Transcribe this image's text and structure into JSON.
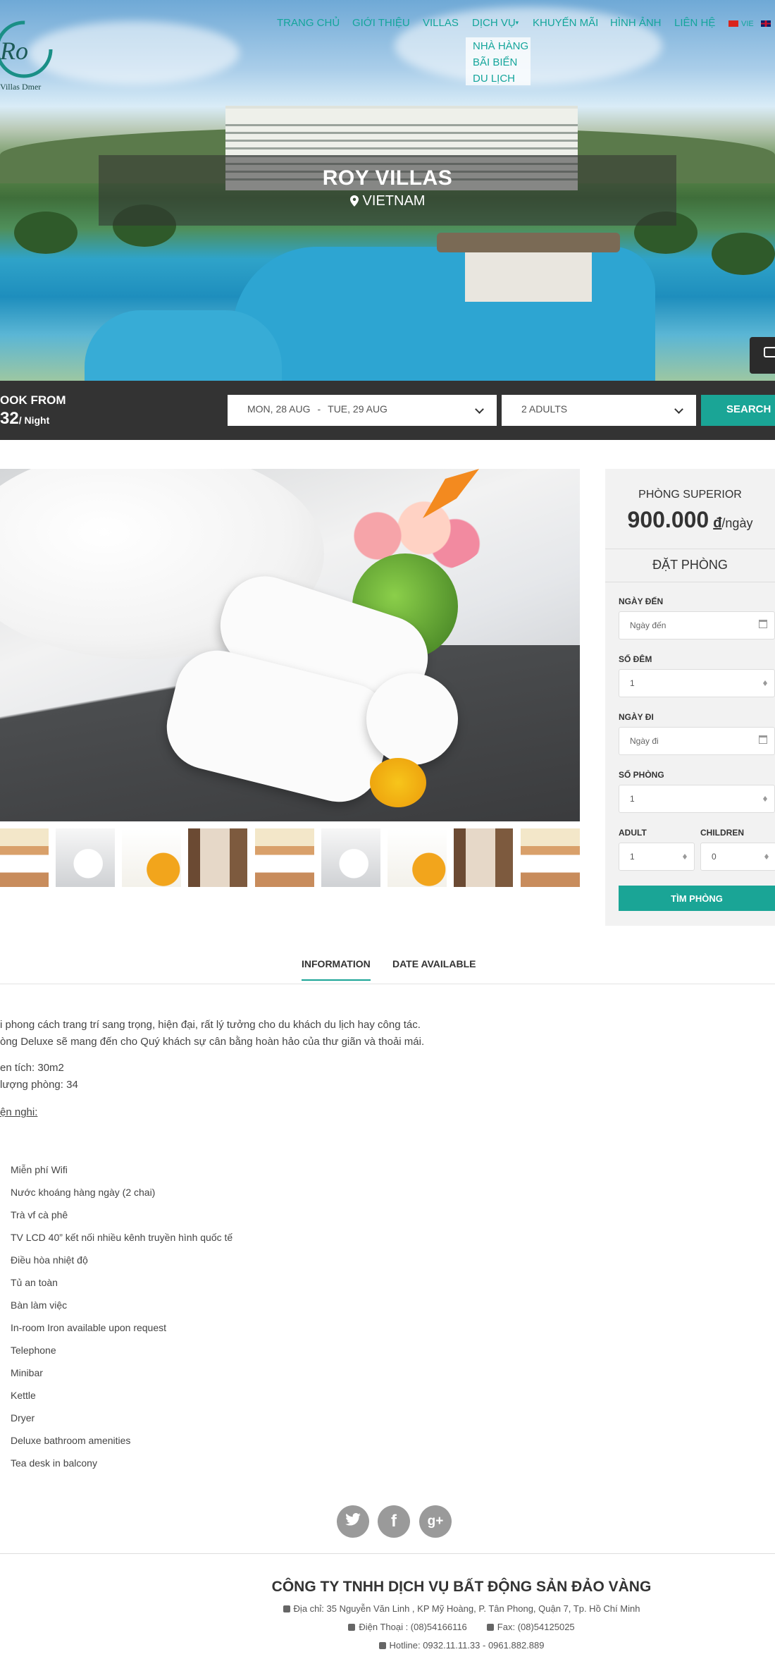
{
  "brand": {
    "logo_text": "Villas Dmer",
    "logo_mark": "Ro"
  },
  "nav": {
    "items": [
      "TRANG CHỦ",
      "GIỚI THIỆU",
      "VILLAS",
      "DỊCH VỤ",
      "KHUYẾN MÃI",
      "HÌNH ẢNH",
      "LIÊN HỆ"
    ],
    "submenu": [
      "NHÀ HÀNG",
      "BÃI BIỂN",
      "DU LỊCH"
    ],
    "lang": [
      "VIE"
    ],
    "accent": "#14a59b"
  },
  "hero": {
    "title": "ROY VILLAS",
    "location": "VIETNAM"
  },
  "bookbar": {
    "label": "OOK FROM",
    "price": "32",
    "per": "/ Night",
    "checkin": "MON, 28 AUG",
    "checkout": "TUE, 29 AUG",
    "dash": "-",
    "guests": "2 ADULTS",
    "search": "SEARCH"
  },
  "sidebar": {
    "room_name": "PHÒNG SUPERIOR",
    "price": "900.000",
    "currency": "đ",
    "unit": "/ngày",
    "book_title": "ĐẶT PHÒNG",
    "arrive_label": "NGÀY ĐẾN",
    "arrive_placeholder": "Ngày đến",
    "nights_label": "SỐ ĐÊM",
    "nights_value": "1",
    "depart_label": "NGÀY ĐI",
    "depart_placeholder": "Ngày đi",
    "rooms_label": "SỐ PHÒNG",
    "rooms_value": "1",
    "adult_label": "ADULT",
    "adult_value": "1",
    "children_label": "CHILDREN",
    "children_value": "0",
    "find_button": "TÌM PHÒNG"
  },
  "tabs": [
    "INFORMATION",
    "DATE AVAILABLE"
  ],
  "content": {
    "lines": [
      "i phong cách trang trí sang trọng, hiện đại, rất lý tưởng cho du khách du lịch hay công tác.",
      "òng Deluxe sẽ mang đến cho Quý khách sự cân bằng hoàn hảo của thư giãn và thoải mái.",
      "en tích: 30m2",
      "lượng phòng: 34",
      "ện nghi:"
    ],
    "amenities": [
      "Miễn phí Wifi",
      "Nước khoáng hàng ngày (2 chai)",
      "Trà vf cà phê",
      "TV LCD 40” kết nối nhiều kênh truyền hình quốc tế",
      "Điều hòa nhiệt độ",
      "Tủ an toàn",
      "Bàn làm việc",
      "In-room Iron available upon request",
      "Telephone",
      "Minibar",
      "Kettle",
      "Dryer",
      "Deluxe bathroom amenities",
      "Tea desk in balcony"
    ]
  },
  "social": {
    "twitter": "twitter-icon",
    "facebook": "f",
    "google": "g+"
  },
  "footer": {
    "company": "CÔNG TY TNHH DỊCH VỤ BẤT ĐỘNG SẢN ĐẢO VÀNG",
    "address": "Địa chỉ: 35 Nguyễn Văn Linh , KP Mỹ Hoàng, P. Tân Phong, Quận 7, Tp. Hồ Chí Minh",
    "phone": "Điện Thoại : (08)54166116",
    "fax": "Fax: (08)54125025",
    "hotline": "Hotline: 0932.11.11.33 - 0961.882.889"
  }
}
